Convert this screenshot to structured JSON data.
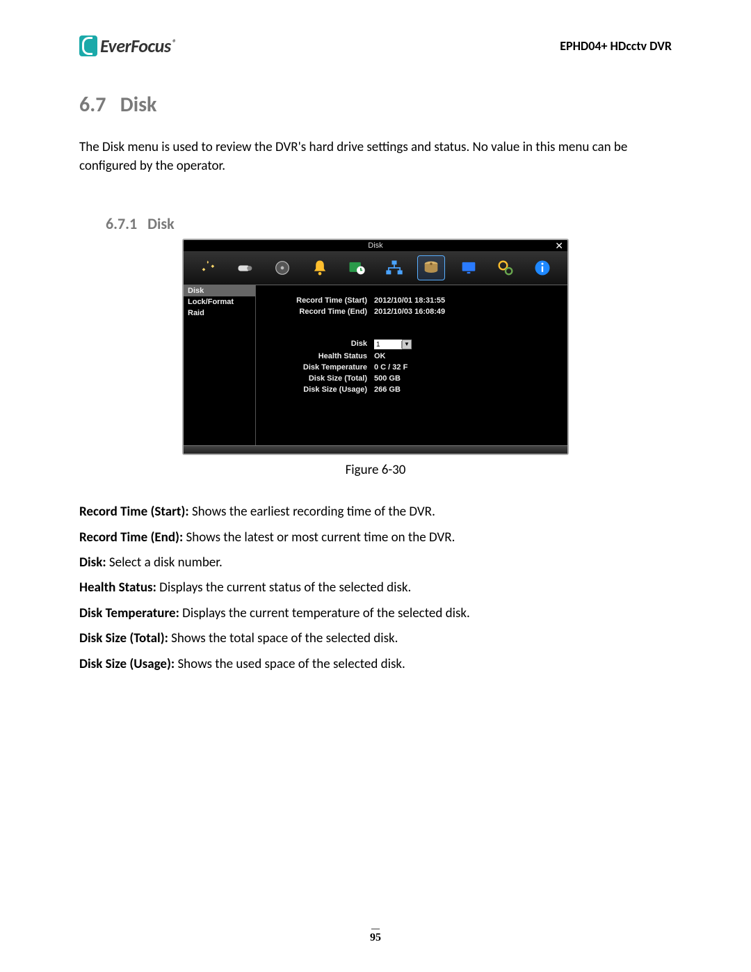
{
  "header": {
    "brand": "EverFocus",
    "registered": "®",
    "product": "EPHD04+  HDcctv DVR"
  },
  "section": {
    "number": "6.7",
    "title": "Disk",
    "intro": "The Disk menu is used to review the DVR's hard drive settings and status. No value in this menu can be configured by the operator."
  },
  "subsection": {
    "number": "6.7.1",
    "title": "Disk"
  },
  "dvr": {
    "title": "Disk",
    "close": "✕",
    "sidebar": [
      {
        "label": "Disk",
        "active": true
      },
      {
        "label": "Lock/Format",
        "active": false
      },
      {
        "label": "Raid",
        "active": false
      }
    ],
    "record_start_label": "Record Time (Start)",
    "record_start_value": "2012/10/01 18:31:55",
    "record_end_label": "Record Time (End)",
    "record_end_value": "2012/10/03 16:08:49",
    "disk_label": "Disk",
    "disk_value": "1",
    "health_label": "Health Status",
    "health_value": "OK",
    "temp_label": "Disk Temperature",
    "temp_value": "0 C / 32 F",
    "size_total_label": "Disk Size (Total)",
    "size_total_value": "500 GB",
    "size_usage_label": "Disk Size (Usage)",
    "size_usage_value": "266 GB"
  },
  "figure_caption": "Figure 6-30",
  "definitions": [
    {
      "term": "Record Time (Start): ",
      "desc": "Shows the earliest recording time of the DVR."
    },
    {
      "term": "Record Time (End): ",
      "desc": "Shows the latest or most current time on the DVR."
    },
    {
      "term": "Disk: ",
      "desc": "Select a disk number."
    },
    {
      "term": "Health Status: ",
      "desc": "Displays the current status of the selected disk."
    },
    {
      "term": "Disk Temperature: ",
      "desc": "Displays the current temperature of the selected disk."
    },
    {
      "term": "Disk Size (Total): ",
      "desc": "Shows the total space of the selected disk."
    },
    {
      "term": "Disk Size (Usage): ",
      "desc": "Shows the used space of the selected disk."
    }
  ],
  "page_number": "95"
}
